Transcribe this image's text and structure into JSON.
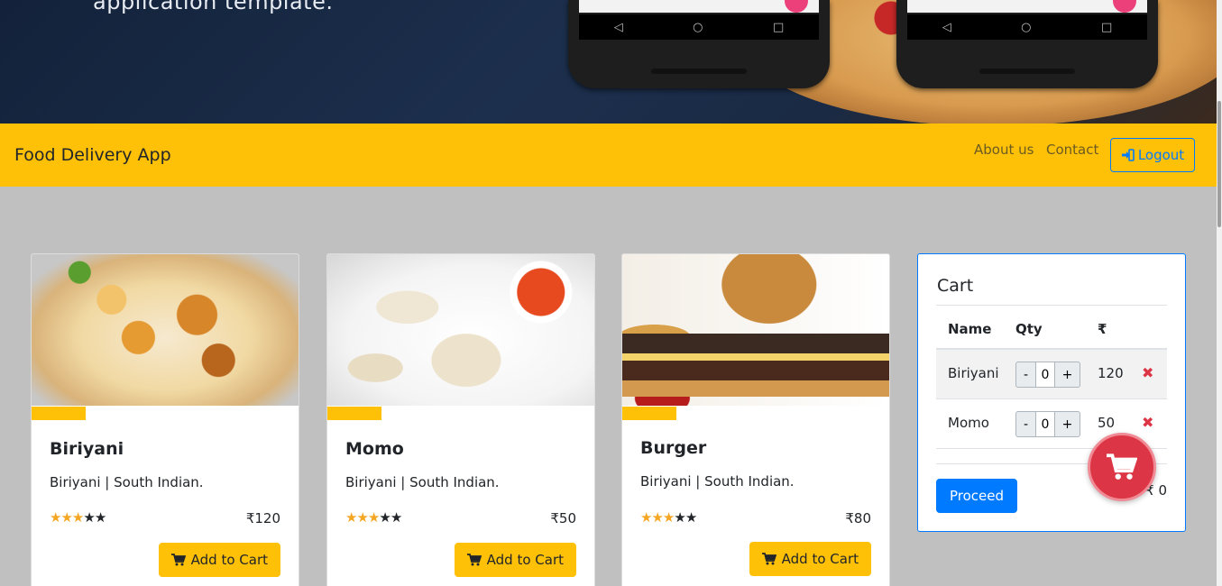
{
  "hero": {
    "text": "application template.",
    "phone_nav": [
      "◁",
      "○",
      "□"
    ]
  },
  "navbar": {
    "brand": "Food Delivery App",
    "links": [
      {
        "label": "About us"
      },
      {
        "label": "Contact"
      }
    ],
    "logout_label": "Logout",
    "logout_icon": "sign-in-icon"
  },
  "products": [
    {
      "name": "Biriyani",
      "description": "Biriyani | South Indian.",
      "rating": 3,
      "rating_max": 5,
      "price": "₹120",
      "button_label": "Add to Cart"
    },
    {
      "name": "Momo",
      "description": "Biriyani | South Indian.",
      "rating": 3,
      "rating_max": 5,
      "price": "₹50",
      "button_label": "Add to Cart"
    },
    {
      "name": "Burger",
      "description": "Biriyani | South Indian.",
      "rating": 3,
      "rating_max": 5,
      "price": "₹80",
      "button_label": "Add to Cart"
    }
  ],
  "cart": {
    "title": "Cart",
    "headers": {
      "name": "Name",
      "qty": "Qty",
      "price": "₹"
    },
    "items": [
      {
        "name": "Biriyani",
        "qty": "0",
        "price": "120"
      },
      {
        "name": "Momo",
        "qty": "0",
        "price": "50"
      }
    ],
    "minus_label": "-",
    "plus_label": "+",
    "remove_icon": "✖",
    "proceed_label": "Proceed",
    "total": "₹ 0"
  },
  "colors": {
    "accent_yellow": "#ffc107",
    "primary_blue": "#007bff",
    "danger_red": "#dc3545",
    "background": "#c0c0c0"
  }
}
